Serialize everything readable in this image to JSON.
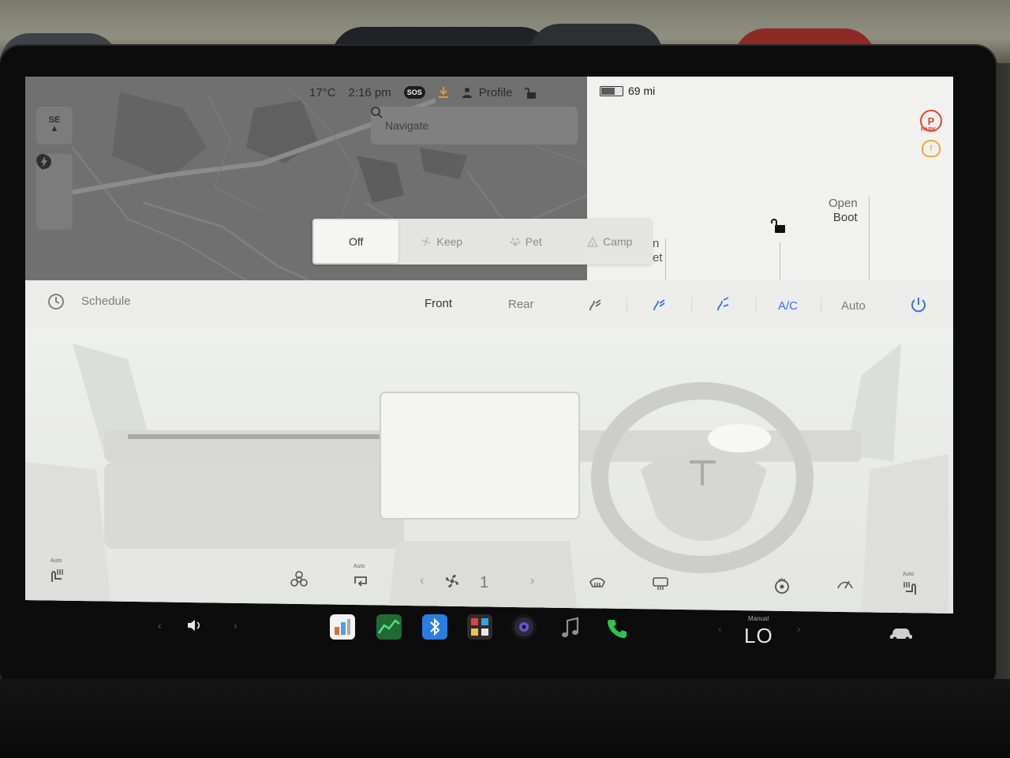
{
  "status_bar": {
    "temperature": "17°C",
    "time": "2:16 pm",
    "sos_label": "SOS",
    "profile_label": "Profile",
    "range": "69 mi",
    "battery_level_fraction": 0.6
  },
  "map": {
    "compass_label": "SE",
    "search_placeholder": "Navigate"
  },
  "vehicle": {
    "park_label": "PARK",
    "park_icon_letter": "P",
    "tpms_icon_glyph": "!",
    "open_boot_line1": "Open",
    "open_boot_line2": "Boot",
    "frunk_fragment_line1": "n",
    "frunk_fragment_line2": "et"
  },
  "climate_keep": {
    "options": [
      {
        "label": "Off",
        "active": true,
        "icon": ""
      },
      {
        "label": "Keep",
        "active": false,
        "icon": "fan-icon"
      },
      {
        "label": "Pet",
        "active": false,
        "icon": "paw-icon"
      },
      {
        "label": "Camp",
        "active": false,
        "icon": "tent-icon"
      }
    ]
  },
  "climate": {
    "schedule_label": "Schedule",
    "front_label": "Front",
    "rear_label": "Rear",
    "ac_label": "A/C",
    "auto_label": "Auto",
    "fan_level": "1",
    "seat_left_auto": "Auto",
    "recirc_auto": "Auto",
    "seat_right_auto": "Auto"
  },
  "dock": {
    "temperature_display": "LO",
    "temperature_mode": "Manual"
  },
  "colors": {
    "accent_blue": "#3c6ee0",
    "park_red": "#e0462f",
    "tpms_amber": "#f1a93a",
    "bluetooth_blue": "#2a7de1",
    "phone_green": "#2fc34a",
    "energy_green": "#2fa84a"
  }
}
